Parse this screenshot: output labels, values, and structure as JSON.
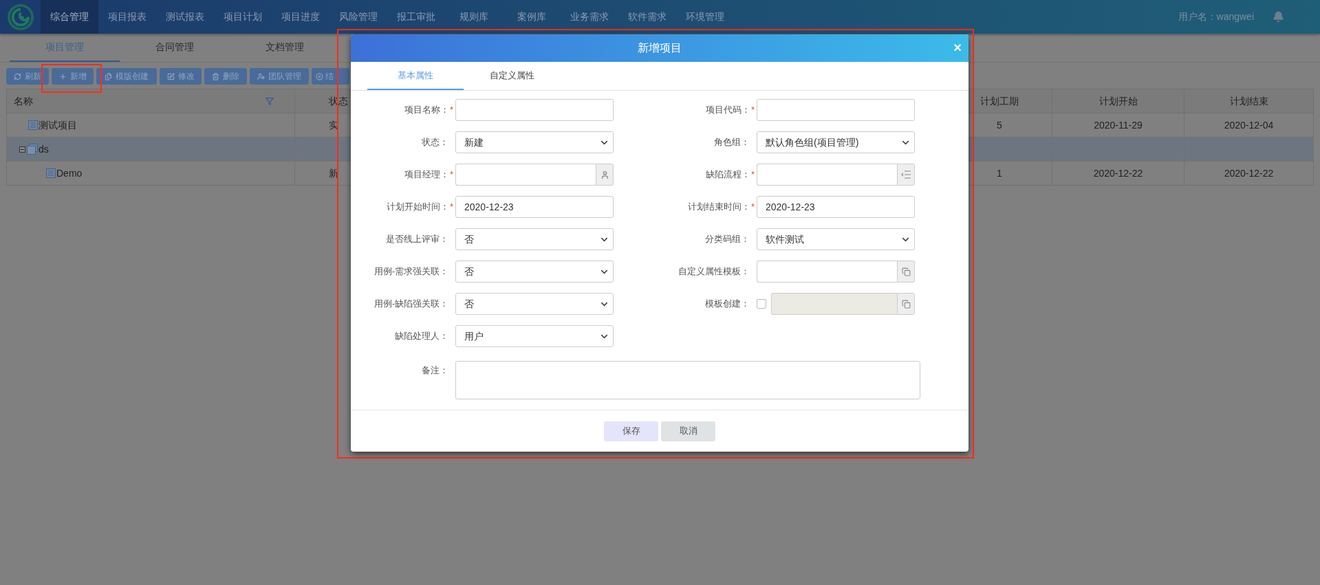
{
  "nav": {
    "items": [
      {
        "label": "综合管理",
        "selected": true
      },
      {
        "label": "项目报表",
        "selected": false
      },
      {
        "label": "测试报表",
        "selected": false
      },
      {
        "label": "项目计划",
        "selected": false
      },
      {
        "label": "项目进度",
        "selected": false
      },
      {
        "label": "风险管理",
        "selected": false
      },
      {
        "label": "报工审批",
        "selected": false
      },
      {
        "label": "规则库",
        "selected": false
      },
      {
        "label": "案例库",
        "selected": false
      },
      {
        "label": "业务需求",
        "selected": false
      },
      {
        "label": "软件需求",
        "selected": false
      },
      {
        "label": "环境管理",
        "selected": false
      }
    ],
    "user": "用户名：wangwei"
  },
  "subtabs": [
    {
      "label": "项目管理",
      "selected": true
    },
    {
      "label": "合同管理",
      "selected": false
    },
    {
      "label": "文档管理",
      "selected": false
    }
  ],
  "toolbar": [
    {
      "kind": "refresh",
      "label": "刷新"
    },
    {
      "kind": "add",
      "label": "新增"
    },
    {
      "kind": "template",
      "label": "模版创建"
    },
    {
      "kind": "edit",
      "label": "修改"
    },
    {
      "kind": "delete",
      "label": "删除"
    },
    {
      "kind": "team",
      "label": "团队管理"
    },
    {
      "kind": "close",
      "label": "结"
    }
  ],
  "table": {
    "columns": [
      "名称",
      "状态",
      "计划工期",
      "计划开始",
      "计划结束"
    ],
    "rows": [
      {
        "kind": "item",
        "name": "测试项目",
        "status": "实",
        "duration": "5",
        "start": "2020-11-29",
        "end": "2020-12-04",
        "selected": false
      },
      {
        "kind": "group",
        "name": "ds",
        "selected": true,
        "expanded": true,
        "children": [
          {
            "kind": "item",
            "name": "Demo",
            "status": "新",
            "duration": "1",
            "start": "2020-12-22",
            "end": "2020-12-22",
            "selected": false
          }
        ]
      }
    ]
  },
  "dialog": {
    "title": "新增项目",
    "close": "×",
    "tabs": [
      {
        "label": "基本属性",
        "selected": true
      },
      {
        "label": "自定义属性",
        "selected": false
      }
    ],
    "fields": [
      {
        "kind": "text",
        "label": "项目名称：",
        "mark": "*"
      },
      {
        "kind": "text",
        "label": "项目代码：",
        "mark": "*"
      },
      {
        "kind": "select",
        "label": "状态：",
        "value": "新建"
      },
      {
        "kind": "select",
        "label": "角色组：",
        "value": "默认角色组(项目管理)"
      },
      {
        "kind": "user",
        "label": "项目经理：",
        "mark": "*"
      },
      {
        "kind": "flow",
        "label": "缺陷流程：",
        "mark": "*"
      },
      {
        "kind": "date",
        "label": "计划开始时间：",
        "mark": "*",
        "value": "2020-12-23"
      },
      {
        "kind": "date",
        "label": "计划结束时间：",
        "mark": "*",
        "value": "2020-12-23"
      },
      {
        "kind": "select",
        "label": "是否线上评审：",
        "value": "否"
      },
      {
        "kind": "select",
        "label": "分类码组：",
        "value": "软件测试"
      },
      {
        "kind": "select",
        "label": "用例-需求强关联：",
        "value": "否"
      },
      {
        "kind": "template",
        "label": "自定义属性模板："
      },
      {
        "kind": "select",
        "label": "用例-缺陷强关联：",
        "value": "否"
      },
      {
        "kind": "option",
        "label": "模板创建：",
        "checked": false
      },
      {
        "kind": "select",
        "label": "缺陷处理人：",
        "value": "用户"
      },
      {
        "kind": "memo",
        "label": "备注："
      }
    ],
    "buttons": [
      {
        "kind": "primary",
        "label": "保存"
      },
      {
        "kind": "secondary",
        "label": "取消"
      }
    ]
  }
}
